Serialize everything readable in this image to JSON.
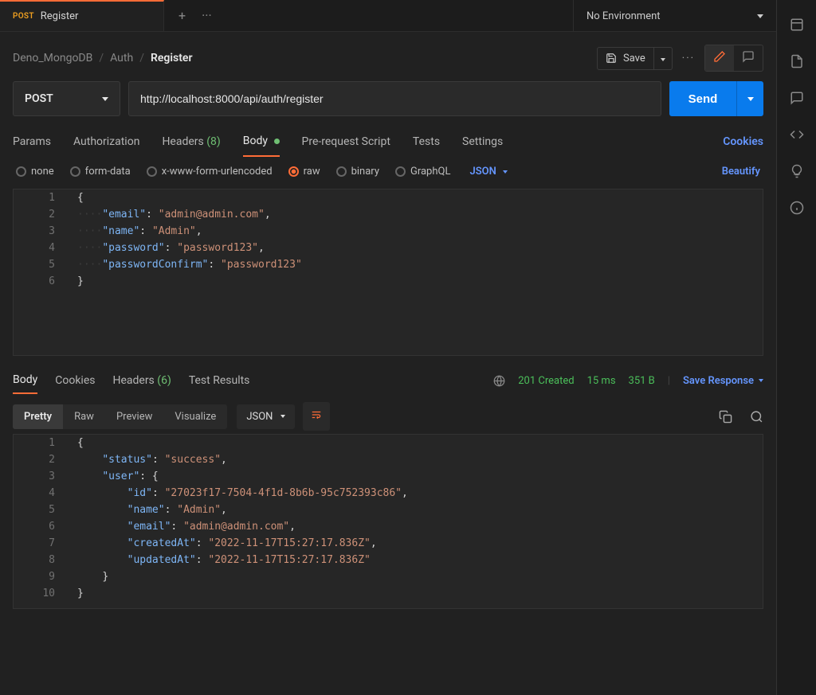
{
  "tab": {
    "method": "POST",
    "title": "Register"
  },
  "env": {
    "label": "No Environment"
  },
  "breadcrumb": {
    "a": "Deno_MongoDB",
    "b": "Auth",
    "c": "Register"
  },
  "save": {
    "label": "Save"
  },
  "request": {
    "method": "POST",
    "url": "http://localhost:8000/api/auth/register",
    "send": "Send"
  },
  "reqTabs": {
    "params": "Params",
    "auth": "Authorization",
    "headers": "Headers",
    "headersCount": "(8)",
    "body": "Body",
    "prereq": "Pre-request Script",
    "tests": "Tests",
    "settings": "Settings",
    "cookies": "Cookies"
  },
  "bodyType": {
    "none": "none",
    "formdata": "form-data",
    "urlenc": "x-www-form-urlencoded",
    "raw": "raw",
    "binary": "binary",
    "graphql": "GraphQL",
    "json": "JSON",
    "beautify": "Beautify"
  },
  "reqBody": {
    "emailKey": "\"email\"",
    "emailVal": "\"admin@admin.com\"",
    "nameKey": "\"name\"",
    "nameVal": "\"Admin\"",
    "pwKey": "\"password\"",
    "pwVal": "\"password123\"",
    "pwcKey": "\"passwordConfirm\"",
    "pwcVal": "\"password123\""
  },
  "respTabs": {
    "body": "Body",
    "cookies": "Cookies",
    "headers": "Headers",
    "headersCount": "(6)",
    "test": "Test Results",
    "status": "201 Created",
    "time": "15 ms",
    "size": "351 B",
    "save": "Save Response"
  },
  "respView": {
    "pretty": "Pretty",
    "raw": "Raw",
    "preview": "Preview",
    "visualize": "Visualize",
    "json": "JSON"
  },
  "respBody": {
    "statusKey": "\"status\"",
    "statusVal": "\"success\"",
    "userKey": "\"user\"",
    "idKey": "\"id\"",
    "idVal": "\"27023f17-7504-4f1d-8b6b-95c752393c86\"",
    "nameKey": "\"name\"",
    "nameVal": "\"Admin\"",
    "emailKey": "\"email\"",
    "emailVal": "\"admin@admin.com\"",
    "caKey": "\"createdAt\"",
    "caVal": "\"2022-11-17T15:27:17.836Z\"",
    "uaKey": "\"updatedAt\"",
    "uaVal": "\"2022-11-17T15:27:17.836Z\""
  }
}
